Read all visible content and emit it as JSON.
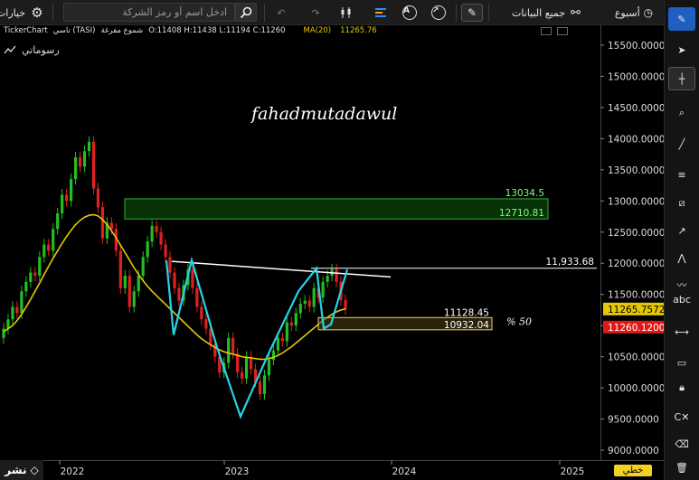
{
  "toolbar": {
    "options_label": "خيارات",
    "search_placeholder": "ادخل اسم أو رمز الشركة",
    "data_label": "جميع البيانات",
    "period_label": "أسبوع"
  },
  "info": {
    "ticker": "TickerChart",
    "symbol": "تاسي (TASI)",
    "candles": "شموع مفرغة",
    "ohlc": "O:11408 H:11438 L:11194 C:11260",
    "ma_label": "MA(20)",
    "ma_value": "11265.76"
  },
  "my_tools_label": "رسوماتي",
  "share_label": "نشر",
  "scale_label": "خطي",
  "chart_data": {
    "type": "candlestick",
    "watermark": "fahadmutadawul",
    "y_ticks": [
      9000,
      9500,
      10000,
      10500,
      11000,
      11500,
      12000,
      12500,
      13000,
      13500,
      14000,
      14500,
      15000,
      15500
    ],
    "y_tick_labels": [
      "9000.0000",
      "9500.0000",
      "10000.0000",
      "10500.0000",
      "11000.0000",
      "11500.0000",
      "12000.0000",
      "12500.0000",
      "13000.0000",
      "13500.0000",
      "14000.0000",
      "14500.0000",
      "15000.0000",
      "15500.0000"
    ],
    "ylim": [
      8800,
      15750
    ],
    "x_tick_labels": [
      "2022",
      "2023",
      "2024",
      "2025"
    ],
    "last_price_label": "11260.1200",
    "ma_price_label": "11265.7572",
    "colors": {
      "up": "#22c022",
      "down": "#e02020",
      "ma": "#e6c800",
      "pattern": "#27d3e6",
      "neckline": "#ffffff",
      "zone_top": "#0f6e0f",
      "zone_bottom": "#e6d26a"
    },
    "levels": [
      {
        "label": "13034.5",
        "value": 13034.5
      },
      {
        "label": "12710.81",
        "value": 12710.81
      },
      {
        "label": "11,933.68",
        "value": 11933.68
      },
      {
        "label": "11128.45",
        "value": 11128.45
      },
      {
        "label": "10932.04",
        "value": 10932.04
      }
    ],
    "annotation": "% 50",
    "series_close": [
      10950,
      11100,
      11300,
      11200,
      11550,
      11700,
      11850,
      11800,
      12100,
      12300,
      12200,
      12550,
      12800,
      13100,
      13000,
      13350,
      13700,
      13550,
      13800,
      13950,
      13200,
      12900,
      12400,
      12650,
      12550,
      12200,
      11600,
      11800,
      11300,
      11550,
      11800,
      12100,
      12350,
      12600,
      12500,
      12300,
      12100,
      11850,
      11600,
      11400,
      11650,
      11900,
      11600,
      11300,
      11100,
      10950,
      10700,
      10500,
      10250,
      10400,
      10800,
      10550,
      10250,
      10150,
      10500,
      10300,
      10100,
      9900,
      10200,
      10450,
      10600,
      10800,
      10750,
      11050,
      11000,
      11200,
      11350,
      11400,
      11300,
      11600,
      11450,
      11700,
      11800,
      11900,
      11700,
      11408,
      11260
    ],
    "series_open": [
      10800,
      10950,
      11100,
      11300,
      11200,
      11550,
      11700,
      11850,
      11800,
      12100,
      12300,
      12200,
      12550,
      12800,
      13100,
      13000,
      13350,
      13700,
      13550,
      13800,
      13950,
      13200,
      12900,
      12400,
      12650,
      12550,
      12200,
      11600,
      11800,
      11300,
      11550,
      11800,
      12100,
      12350,
      12600,
      12500,
      12300,
      12100,
      11850,
      11600,
      11400,
      11650,
      11900,
      11600,
      11300,
      11100,
      10950,
      10700,
      10500,
      10250,
      10400,
      10800,
      10550,
      10250,
      10150,
      10500,
      10300,
      10100,
      9900,
      10200,
      10450,
      10600,
      10800,
      10750,
      11050,
      11000,
      11200,
      11350,
      11400,
      11300,
      11600,
      11450,
      11700,
      11800,
      11900,
      11700,
      11408
    ],
    "ma20": [
      10900,
      10950,
      11000,
      11080,
      11180,
      11300,
      11420,
      11550,
      11680,
      11820,
      11950,
      12080,
      12200,
      12320,
      12430,
      12530,
      12620,
      12690,
      12740,
      12770,
      12780,
      12760,
      12700,
      12620,
      12520,
      12410,
      12290,
      12170,
      12050,
      11930,
      11820,
      11720,
      11630,
      11550,
      11480,
      11410,
      11340,
      11270,
      11200,
      11130,
      11060,
      10990,
      10920,
      10850,
      10790,
      10740,
      10690,
      10650,
      10610,
      10580,
      10560,
      10540,
      10520,
      10500,
      10490,
      10480,
      10470,
      10460,
      10460,
      10470,
      10490,
      10520,
      10560,
      10610,
      10660,
      10720,
      10780,
      10840,
      10900,
      10960,
      11020,
      11080,
      11130,
      11180,
      11220,
      11250,
      11265
    ]
  }
}
